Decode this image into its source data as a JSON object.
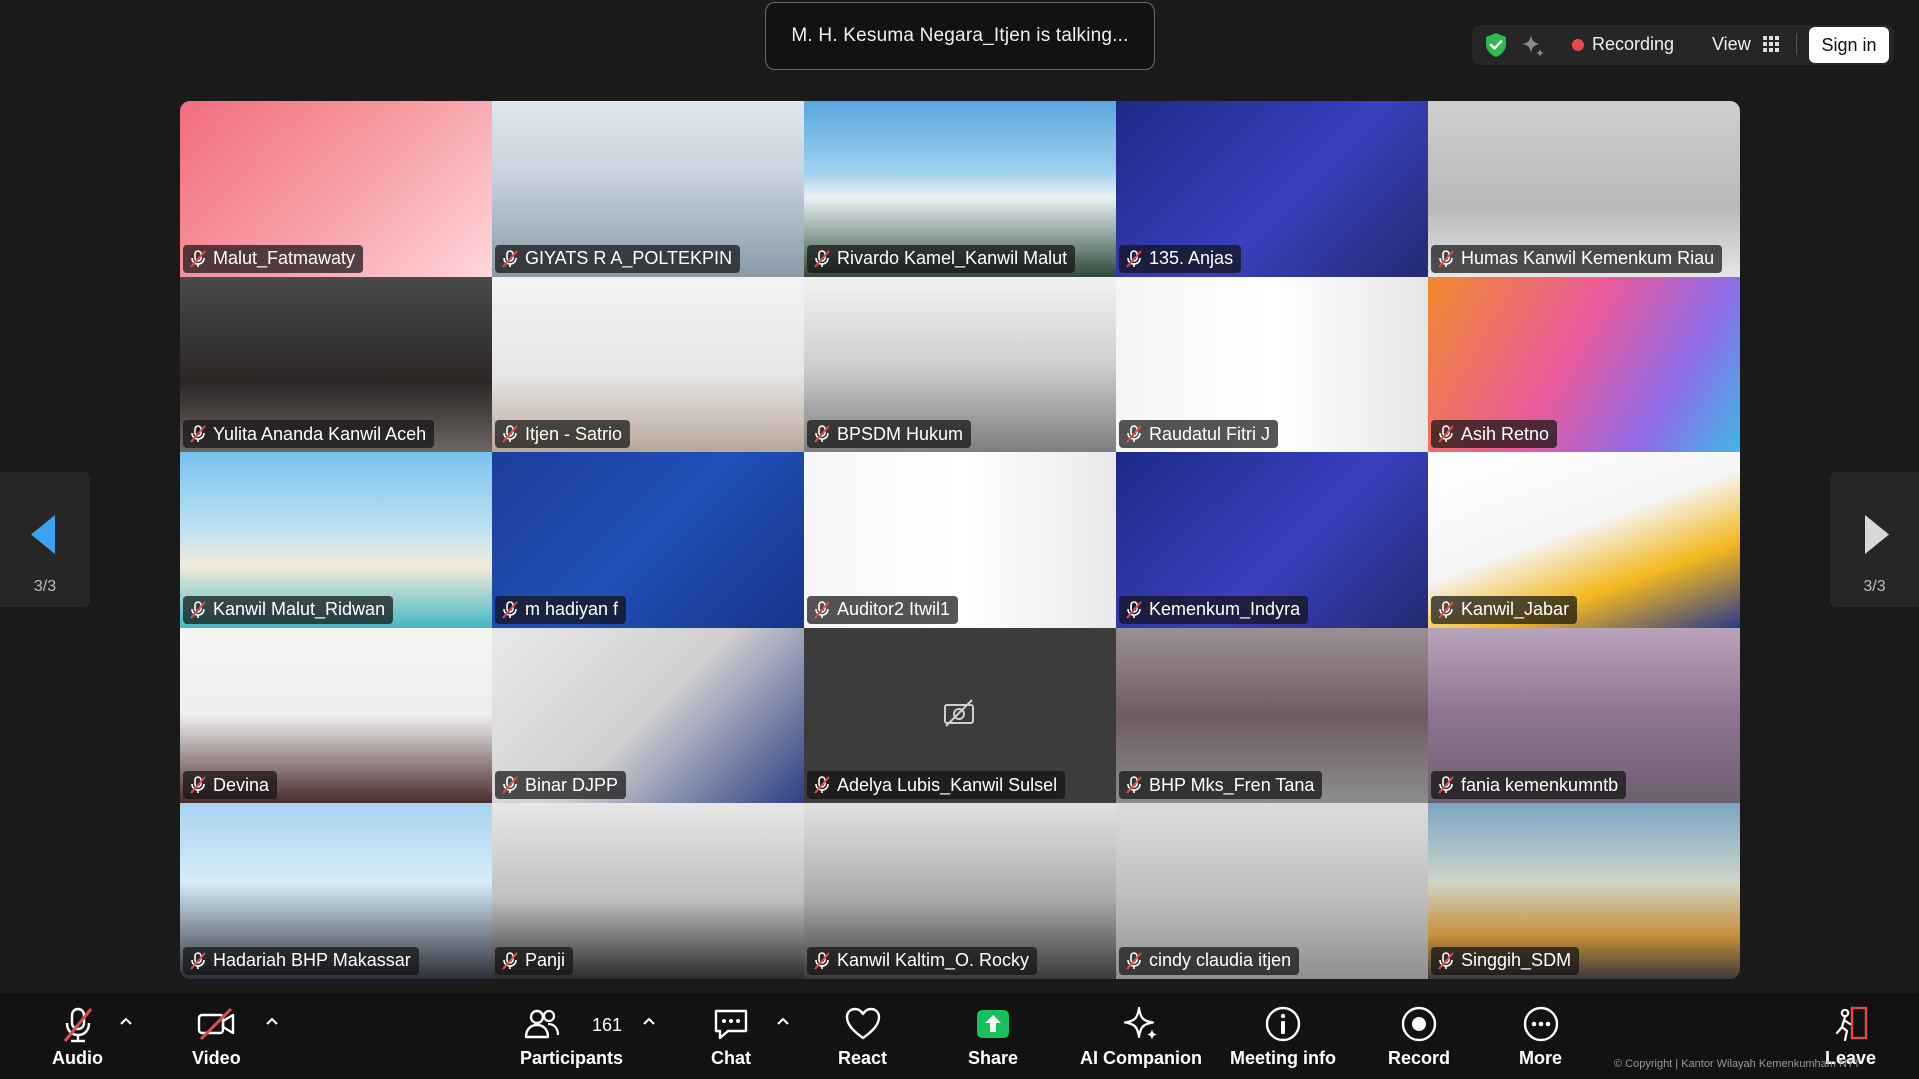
{
  "meeting": {
    "talking_indicator": "M. H. Kesuma Negara_Itjen is talking...",
    "recording_label": "Recording",
    "view_label": "View",
    "sign_in_label": "Sign in",
    "page_indicator": "3/3"
  },
  "colors": {
    "recording": "#e8484b",
    "shield": "#2eb84d",
    "share": "#16c05a",
    "muted": "#e14b4b"
  },
  "participants": [
    {
      "name": "Malut_Fatmawaty"
    },
    {
      "name": "GIYATS R A_POLTEKPIN"
    },
    {
      "name": "Rivardo Kamel_Kanwil Malut"
    },
    {
      "name": "135. Anjas"
    },
    {
      "name": "Humas Kanwil Kemenkum Riau"
    },
    {
      "name": "Yulita Ananda Kanwil Aceh"
    },
    {
      "name": "Itjen - Satrio"
    },
    {
      "name": "BPSDM Hukum"
    },
    {
      "name": "Raudatul Fitri J"
    },
    {
      "name": "Asih Retno"
    },
    {
      "name": "Kanwil Malut_Ridwan"
    },
    {
      "name": "m hadiyan f"
    },
    {
      "name": "Auditor2 Itwil1"
    },
    {
      "name": "Kemenkum_Indyra"
    },
    {
      "name": "Kanwil_Jabar"
    },
    {
      "name": "Devina"
    },
    {
      "name": "Binar DJPP"
    },
    {
      "name": "Adelya Lubis_Kanwil Sulsel"
    },
    {
      "name": "BHP Mks_Fren Tana"
    },
    {
      "name": "fania kemenkumntb"
    },
    {
      "name": "Hadariah BHP Makassar"
    },
    {
      "name": "Panji"
    },
    {
      "name": "Kanwil Kaltim_O. Rocky"
    },
    {
      "name": "cindy claudia itjen"
    },
    {
      "name": "Singgih_SDM"
    }
  ],
  "toolbar": {
    "audio": "Audio",
    "video": "Video",
    "participants": "Participants",
    "participant_count": "161",
    "chat": "Chat",
    "react": "React",
    "share": "Share",
    "ai_companion": "AI Companion",
    "meeting_info": "Meeting info",
    "record": "Record",
    "more": "More",
    "leave": "Leave"
  },
  "copyright": "© Copyright | Kantor Wilayah Kemenkumham NTT"
}
